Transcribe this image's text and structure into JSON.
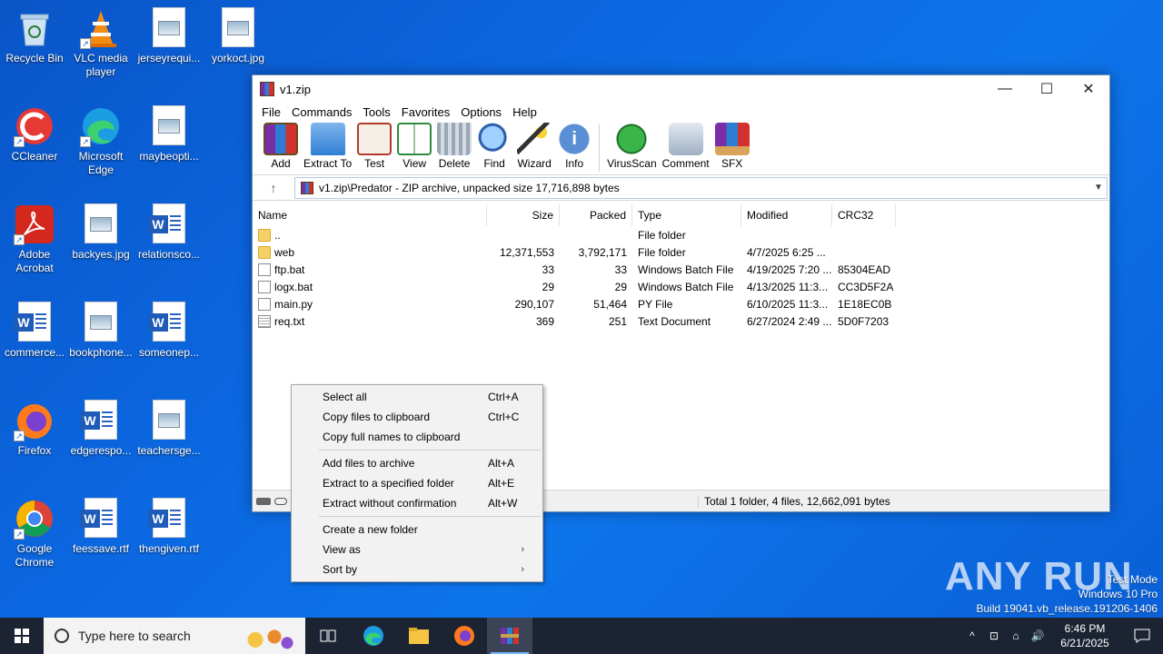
{
  "desktop": {
    "icons": [
      {
        "label": "Recycle Bin"
      },
      {
        "label": "VLC media player"
      },
      {
        "label": "jerseyrequi..."
      },
      {
        "label": "yorkoct.jpg"
      },
      {
        "label": "CCleaner"
      },
      {
        "label": "Microsoft Edge"
      },
      {
        "label": "maybeopti..."
      },
      {
        "label": "Adobe Acrobat"
      },
      {
        "label": "backyes.jpg"
      },
      {
        "label": "relationsco..."
      },
      {
        "label": "commerce..."
      },
      {
        "label": "bookphone..."
      },
      {
        "label": "someonep..."
      },
      {
        "label": "Firefox"
      },
      {
        "label": "edgerespo..."
      },
      {
        "label": "teachersge..."
      },
      {
        "label": "Google Chrome"
      },
      {
        "label": "feessave.rtf"
      },
      {
        "label": "thengiven.rtf"
      }
    ]
  },
  "window": {
    "title": "v1.zip",
    "minimize": "—",
    "maximize": "☐",
    "close": "✕",
    "menu": [
      "File",
      "Commands",
      "Tools",
      "Favorites",
      "Options",
      "Help"
    ],
    "toolbar": [
      "Add",
      "Extract To",
      "Test",
      "View",
      "Delete",
      "Find",
      "Wizard",
      "Info",
      "VirusScan",
      "Comment",
      "SFX"
    ],
    "path": "v1.zip\\Predator - ZIP archive, unpacked size 17,716,898 bytes",
    "columns": {
      "name": "Name",
      "size": "Size",
      "packed": "Packed",
      "type": "Type",
      "modified": "Modified",
      "crc": "CRC32"
    },
    "rows": [
      {
        "name": "..",
        "size": "",
        "packed": "",
        "type": "File folder",
        "modified": "",
        "crc": "",
        "kind": "folder"
      },
      {
        "name": "web",
        "size": "12,371,553",
        "packed": "3,792,171",
        "type": "File folder",
        "modified": "4/7/2025 6:25 ...",
        "crc": "",
        "kind": "folder"
      },
      {
        "name": "ftp.bat",
        "size": "33",
        "packed": "33",
        "type": "Windows Batch File",
        "modified": "4/19/2025 7:20 ...",
        "crc": "85304EAD",
        "kind": "bat"
      },
      {
        "name": "logx.bat",
        "size": "29",
        "packed": "29",
        "type": "Windows Batch File",
        "modified": "4/13/2025 11:3...",
        "crc": "CC3D5F2A",
        "kind": "bat"
      },
      {
        "name": "main.py",
        "size": "290,107",
        "packed": "51,464",
        "type": "PY File",
        "modified": "6/10/2025 11:3...",
        "crc": "1E18EC0B",
        "kind": "py"
      },
      {
        "name": "req.txt",
        "size": "369",
        "packed": "251",
        "type": "Text Document",
        "modified": "6/27/2024 2:49 ...",
        "crc": "5D0F7203",
        "kind": "txt"
      }
    ],
    "status": "Total 1 folder, 4 files, 12,662,091 bytes"
  },
  "context_menu": {
    "items": [
      {
        "label": "Select all",
        "key": "Ctrl+A"
      },
      {
        "label": "Copy files to clipboard",
        "key": "Ctrl+C"
      },
      {
        "label": "Copy full names to clipboard",
        "key": ""
      },
      {
        "label": "Add files to archive",
        "key": "Alt+A"
      },
      {
        "label": "Extract to a specified folder",
        "key": "Alt+E"
      },
      {
        "label": "Extract without confirmation",
        "key": "Alt+W"
      },
      {
        "label": "Create a new folder",
        "key": ""
      },
      {
        "label": "View as",
        "key": "›"
      },
      {
        "label": "Sort by",
        "key": "›"
      }
    ]
  },
  "taskbar": {
    "search_placeholder": "Type here to search",
    "time": "6:46 PM",
    "date": "6/21/2025"
  },
  "watermark": {
    "brand": "ANY RUN",
    "line1": "Test Mode",
    "line2": "Windows 10 Pro",
    "line3": "Build 19041.vb_release.191206-1406"
  },
  "colors": {
    "accent": "#0b67e0",
    "taskbar": "#1c2433"
  }
}
